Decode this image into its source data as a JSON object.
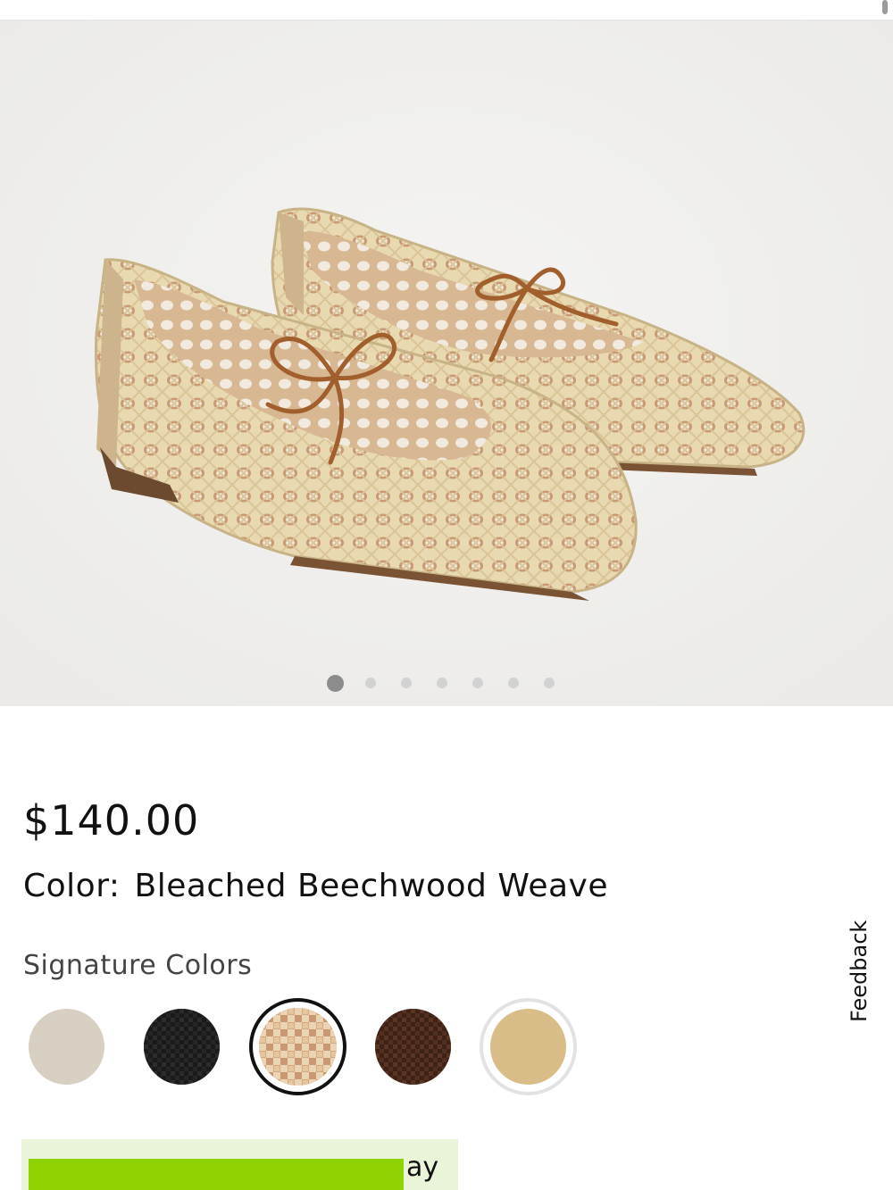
{
  "product": {
    "image_alt": "Woven raffia ballet flats with brown leather bow ties",
    "gallery_dots": 7,
    "active_image_index": 0,
    "price": "$140.00",
    "color_label": "Color:",
    "color_value": "Bleached Beechwood Weave"
  },
  "signature_colors": {
    "label": "Signature Colors",
    "swatches": [
      {
        "name": "light-taupe",
        "color": "#d8cfc3",
        "selected": false
      },
      {
        "name": "black-weave",
        "color": "#1a1a1a",
        "selected": false
      },
      {
        "name": "bleached-beechwood-weave",
        "color": "#e0c4a0",
        "selected": true
      },
      {
        "name": "brown-weave",
        "color": "#4a2a1c",
        "selected": false
      },
      {
        "name": "natural-tan",
        "color": "#d8bd88",
        "selected": false
      }
    ]
  },
  "feedback": {
    "label": "Feedback"
  },
  "payment": {
    "text": "ay",
    "bar_color": "#8fd400",
    "box_color": "#e9f4d9"
  }
}
